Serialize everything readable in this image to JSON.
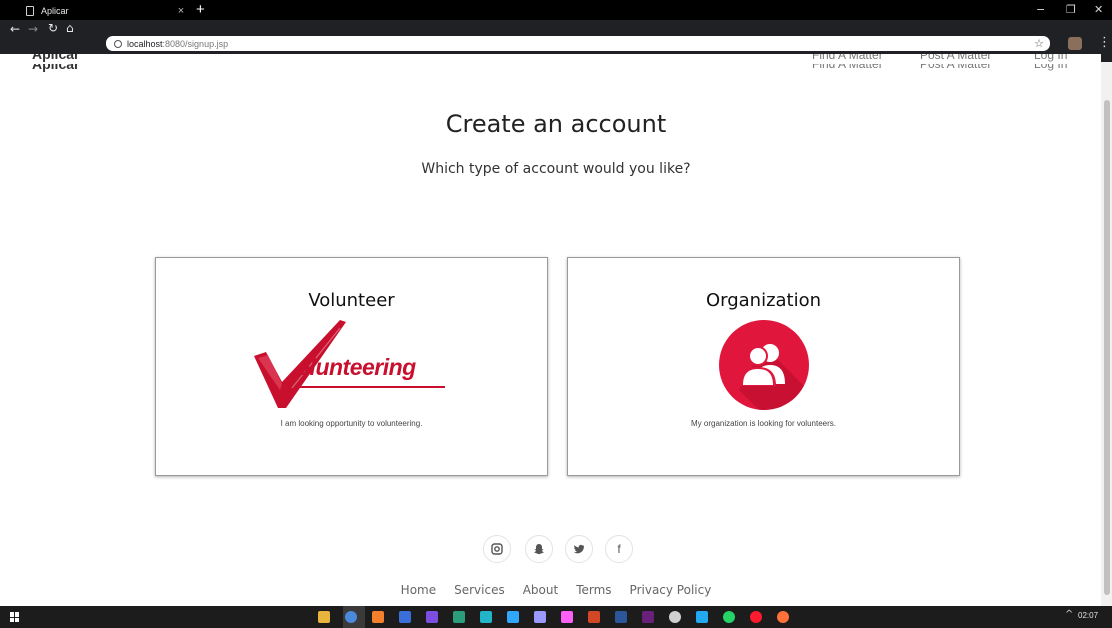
{
  "browser": {
    "tab_title": "Aplicar",
    "tab_close": "×",
    "new_tab": "+",
    "url_host": "localhost",
    "url_rest": ":8080/signup.jsp",
    "icons": [
      "page-icon",
      "back-icon",
      "forward-icon",
      "reload-icon",
      "home-icon",
      "info-icon",
      "star-icon",
      "profile-avatar",
      "menu-icon"
    ],
    "window_controls": [
      "−",
      "❐",
      "✕"
    ]
  },
  "site": {
    "brand": "Aplicar",
    "nav": [
      "Find A Matter",
      "Post A Matter",
      "Log In"
    ]
  },
  "main": {
    "title": "Create an account",
    "subtitle": "Which type of account would you like?",
    "cards": [
      {
        "title": "Volunteer",
        "logo_text": "olunteering",
        "description": "I am looking opportunity to volunteering."
      },
      {
        "title": "Organization",
        "description": "My organization is looking for volunteers."
      }
    ]
  },
  "footer": {
    "social": [
      "instagram-icon",
      "snapchat-icon",
      "twitter-icon",
      "facebook-icon"
    ],
    "facebook_glyph": "f",
    "links": [
      "Home",
      "Services",
      "About",
      "Terms",
      "Privacy Policy"
    ]
  },
  "taskbar": {
    "clock": "02:07",
    "tray_chevron": "^",
    "icons": [
      "file-explorer-icon",
      "chrome-icon",
      "sublime-icon",
      "app-icon",
      "intellij-icon",
      "datagrip-icon",
      "webstorm-icon",
      "photoshop-icon",
      "premiere-icon",
      "xd-icon",
      "powerpoint-icon",
      "word-icon",
      "visual-studio-icon",
      "media-icon",
      "vscode-icon",
      "whatsapp-icon",
      "opera-icon",
      "firefox-icon"
    ],
    "icon_colors": [
      "#e9b43c",
      "#4a89dc",
      "#f3812b",
      "#3b6fd8",
      "#7b4fe0",
      "#2b9c7c",
      "#22b4c8",
      "#31a8ff",
      "#9999ff",
      "#ff61f6",
      "#d24726",
      "#2b579a",
      "#68217a",
      "#cfcfcf",
      "#23a9f2",
      "#25d366",
      "#ff1b2d",
      "#ff7139"
    ]
  },
  "colors": {
    "accent_red": "#c8102e",
    "org_red": "#e0163d"
  }
}
